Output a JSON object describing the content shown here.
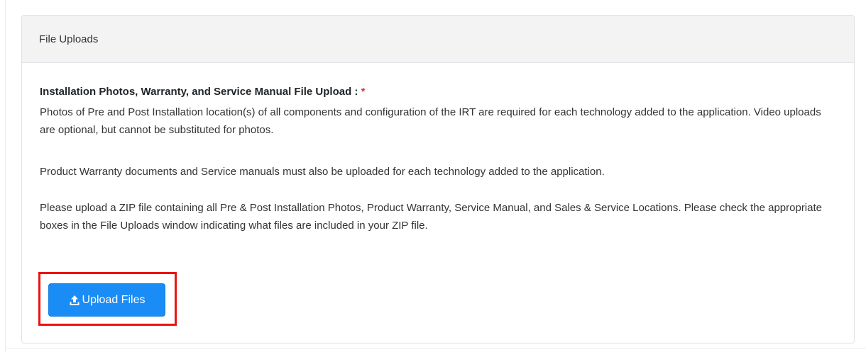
{
  "card": {
    "header_title": "File Uploads"
  },
  "section": {
    "label": "Installation Photos, Warranty, and Service Manual File Upload :",
    "required_marker": "*",
    "paragraphs": [
      "Photos of Pre and Post Installation location(s) of all components and configuration of the IRT are required for each technology added to the application. Video uploads are optional, but cannot be substituted for photos.",
      "Product Warranty documents and Service manuals must also be uploaded for each technology added to the application.",
      "Please upload a ZIP file containing all Pre & Post Installation Photos, Product Warranty, Service Manual, and Sales & Service Locations. Please check the appropriate boxes in the File Uploads window indicating what files are included in your ZIP file."
    ]
  },
  "upload_button": {
    "label": "Upload Files",
    "icon": "upload-icon"
  },
  "colors": {
    "button_blue": "#1a8cf5",
    "highlight_red": "#ee1111",
    "required_red": "#dc3545",
    "header_bg": "#f3f3f3"
  }
}
